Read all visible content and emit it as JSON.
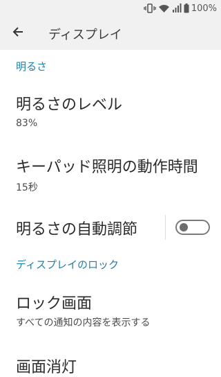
{
  "status_bar": {
    "battery_text": "100%",
    "icons": [
      "vibrate-icon",
      "wifi-icon",
      "signal-icon",
      "battery-icon"
    ]
  },
  "app_bar": {
    "title": "ディスプレイ",
    "back_icon": "arrow-back-icon"
  },
  "sections": {
    "brightness": {
      "header": "明るさ",
      "level_title": "明るさのレベル",
      "level_value": "83%",
      "keypad_title": "キーパッド照明の動作時間",
      "keypad_value": "15秒",
      "auto_title": "明るさの自動調節",
      "auto_enabled": false
    },
    "lock": {
      "header": "ディスプレイのロック",
      "lock_screen_title": "ロック画面",
      "lock_screen_sub": "すべての通知の内容を表示する",
      "screen_off_title": "画面消灯"
    }
  },
  "colors": {
    "accent": "#1f7fa8",
    "bar_background": "#f1f1f1"
  }
}
